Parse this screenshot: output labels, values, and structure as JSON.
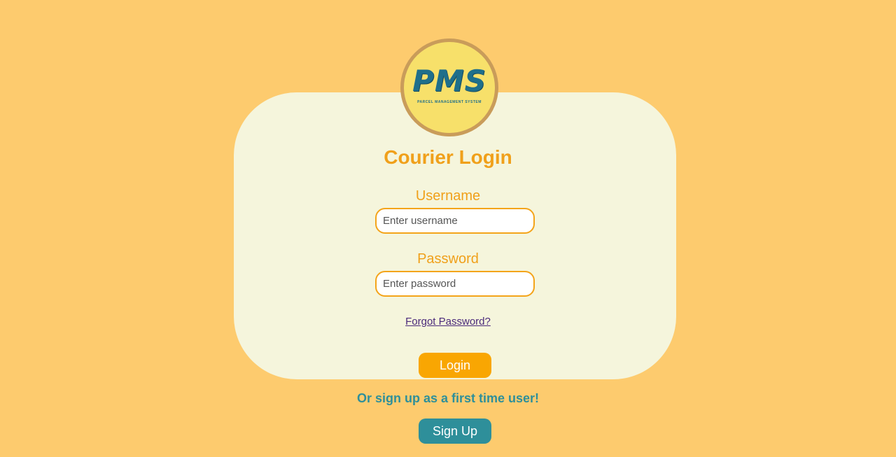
{
  "logo": {
    "text": "PMS",
    "subtitle": "PARCEL MANAGEMENT SYSTEM",
    "icon": "pms-logo"
  },
  "login": {
    "title": "Courier Login",
    "username_label": "Username",
    "username_placeholder": "Enter username",
    "username_value": "",
    "password_label": "Password",
    "password_placeholder": "Enter password",
    "password_value": "",
    "forgot_link": "Forgot Password?",
    "login_button": "Login"
  },
  "signup": {
    "prompt": "Or sign up as a first time user!",
    "button": "Sign Up"
  },
  "colors": {
    "background": "#fdcb6e",
    "card": "#f5f5dc",
    "accent": "#f0a01a",
    "login_button": "#f9a602",
    "signup": "#2e8f9a",
    "link": "#4b2a7b"
  }
}
